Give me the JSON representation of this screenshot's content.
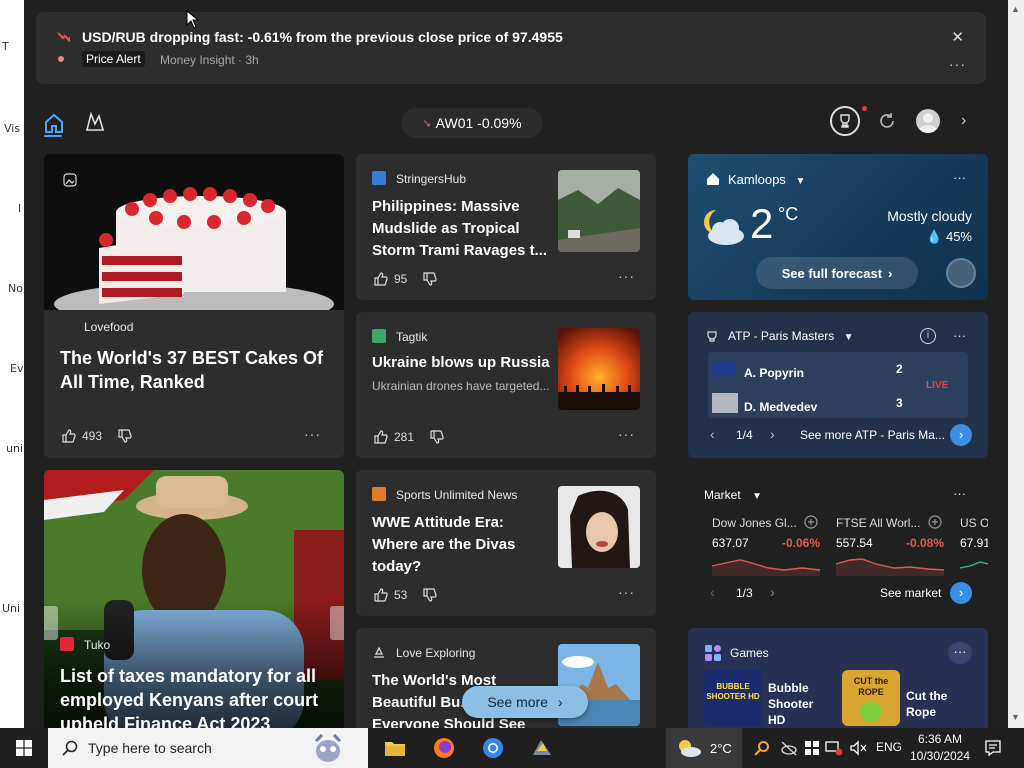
{
  "desktop": {
    "labels": [
      "T",
      "Vis",
      "I",
      "No",
      "Ev",
      "uni",
      "Uni"
    ]
  },
  "alert": {
    "title": "USD/RUB dropping fast: -0.61% from the previous close price of 97.4955",
    "badge": "Price Alert",
    "meta": "Money Insight · 3h",
    "close": "✕",
    "more": "···"
  },
  "toolbar": {
    "ticker": "AW01 -0.09%",
    "chevron": "›"
  },
  "cards": {
    "cake": {
      "source": "Lovefood",
      "title": "The World's 37 BEST Cakes Of All Time, Ranked",
      "likes": "493",
      "more": "···"
    },
    "kenya": {
      "source": "Tuko",
      "title": "List of taxes mandatory for all employed Kenyans after court upheld Finance Act 2023"
    },
    "philippines": {
      "source": "StringersHub",
      "title": "Philippines: Massive Mudslide as Tropical Storm Trami Ravages t...",
      "likes": "95",
      "more": "···"
    },
    "ukraine": {
      "source": "Tagtik",
      "title": "Ukraine blows up Russia",
      "snippet": "Ukrainian drones have targeted...",
      "likes": "281",
      "more": "···"
    },
    "wwe": {
      "source": "Sports Unlimited News",
      "title": "WWE Attitude Era: Where are the Divas today?",
      "likes": "53",
      "more": "···"
    },
    "explore": {
      "source": "Love Exploring",
      "title": "The World's Most Beautiful Bu... Everyone Should See"
    }
  },
  "weather": {
    "location": "Kamloops",
    "temp": "2",
    "unit": "°C",
    "condition": "Mostly cloudy",
    "humidity": "45%",
    "button": "See full forecast",
    "more": "···"
  },
  "sports": {
    "title": "ATP - Paris Masters",
    "more": "···",
    "player1": "A. Popyrin",
    "score1": "2",
    "player2": "D. Medvedev",
    "score2": "3",
    "live": "LIVE",
    "pager": "1/4",
    "see_more": "See more ATP - Paris Ma..."
  },
  "market": {
    "title": "Market",
    "more": "···",
    "items": [
      {
        "name": "Dow Jones Gl...",
        "value": "637.07",
        "change": "-0.06%"
      },
      {
        "name": "FTSE All Worl...",
        "value": "557.54",
        "change": "-0.08%"
      },
      {
        "name": "US O",
        "value": "67.91",
        "change": ""
      }
    ],
    "pager": "1/3",
    "see_market": "See market"
  },
  "games": {
    "title": "Games",
    "more": "···",
    "items": [
      {
        "name": "Bubble Shooter HD",
        "logo": "BUBBLE SHOOTER HD"
      },
      {
        "name": "Cut the Rope",
        "logo": "CUT the ROPE"
      }
    ]
  },
  "see_more": "See more",
  "taskbar": {
    "search_placeholder": "Type here to search",
    "weather_temp": "2°C",
    "lang": "ENG",
    "time": "6:36 AM",
    "date": "10/30/2024"
  },
  "colors": {
    "accent": "#4aa3ff",
    "negative": "#e05a4f",
    "alert_badge_bg": "#1b1b1b"
  }
}
